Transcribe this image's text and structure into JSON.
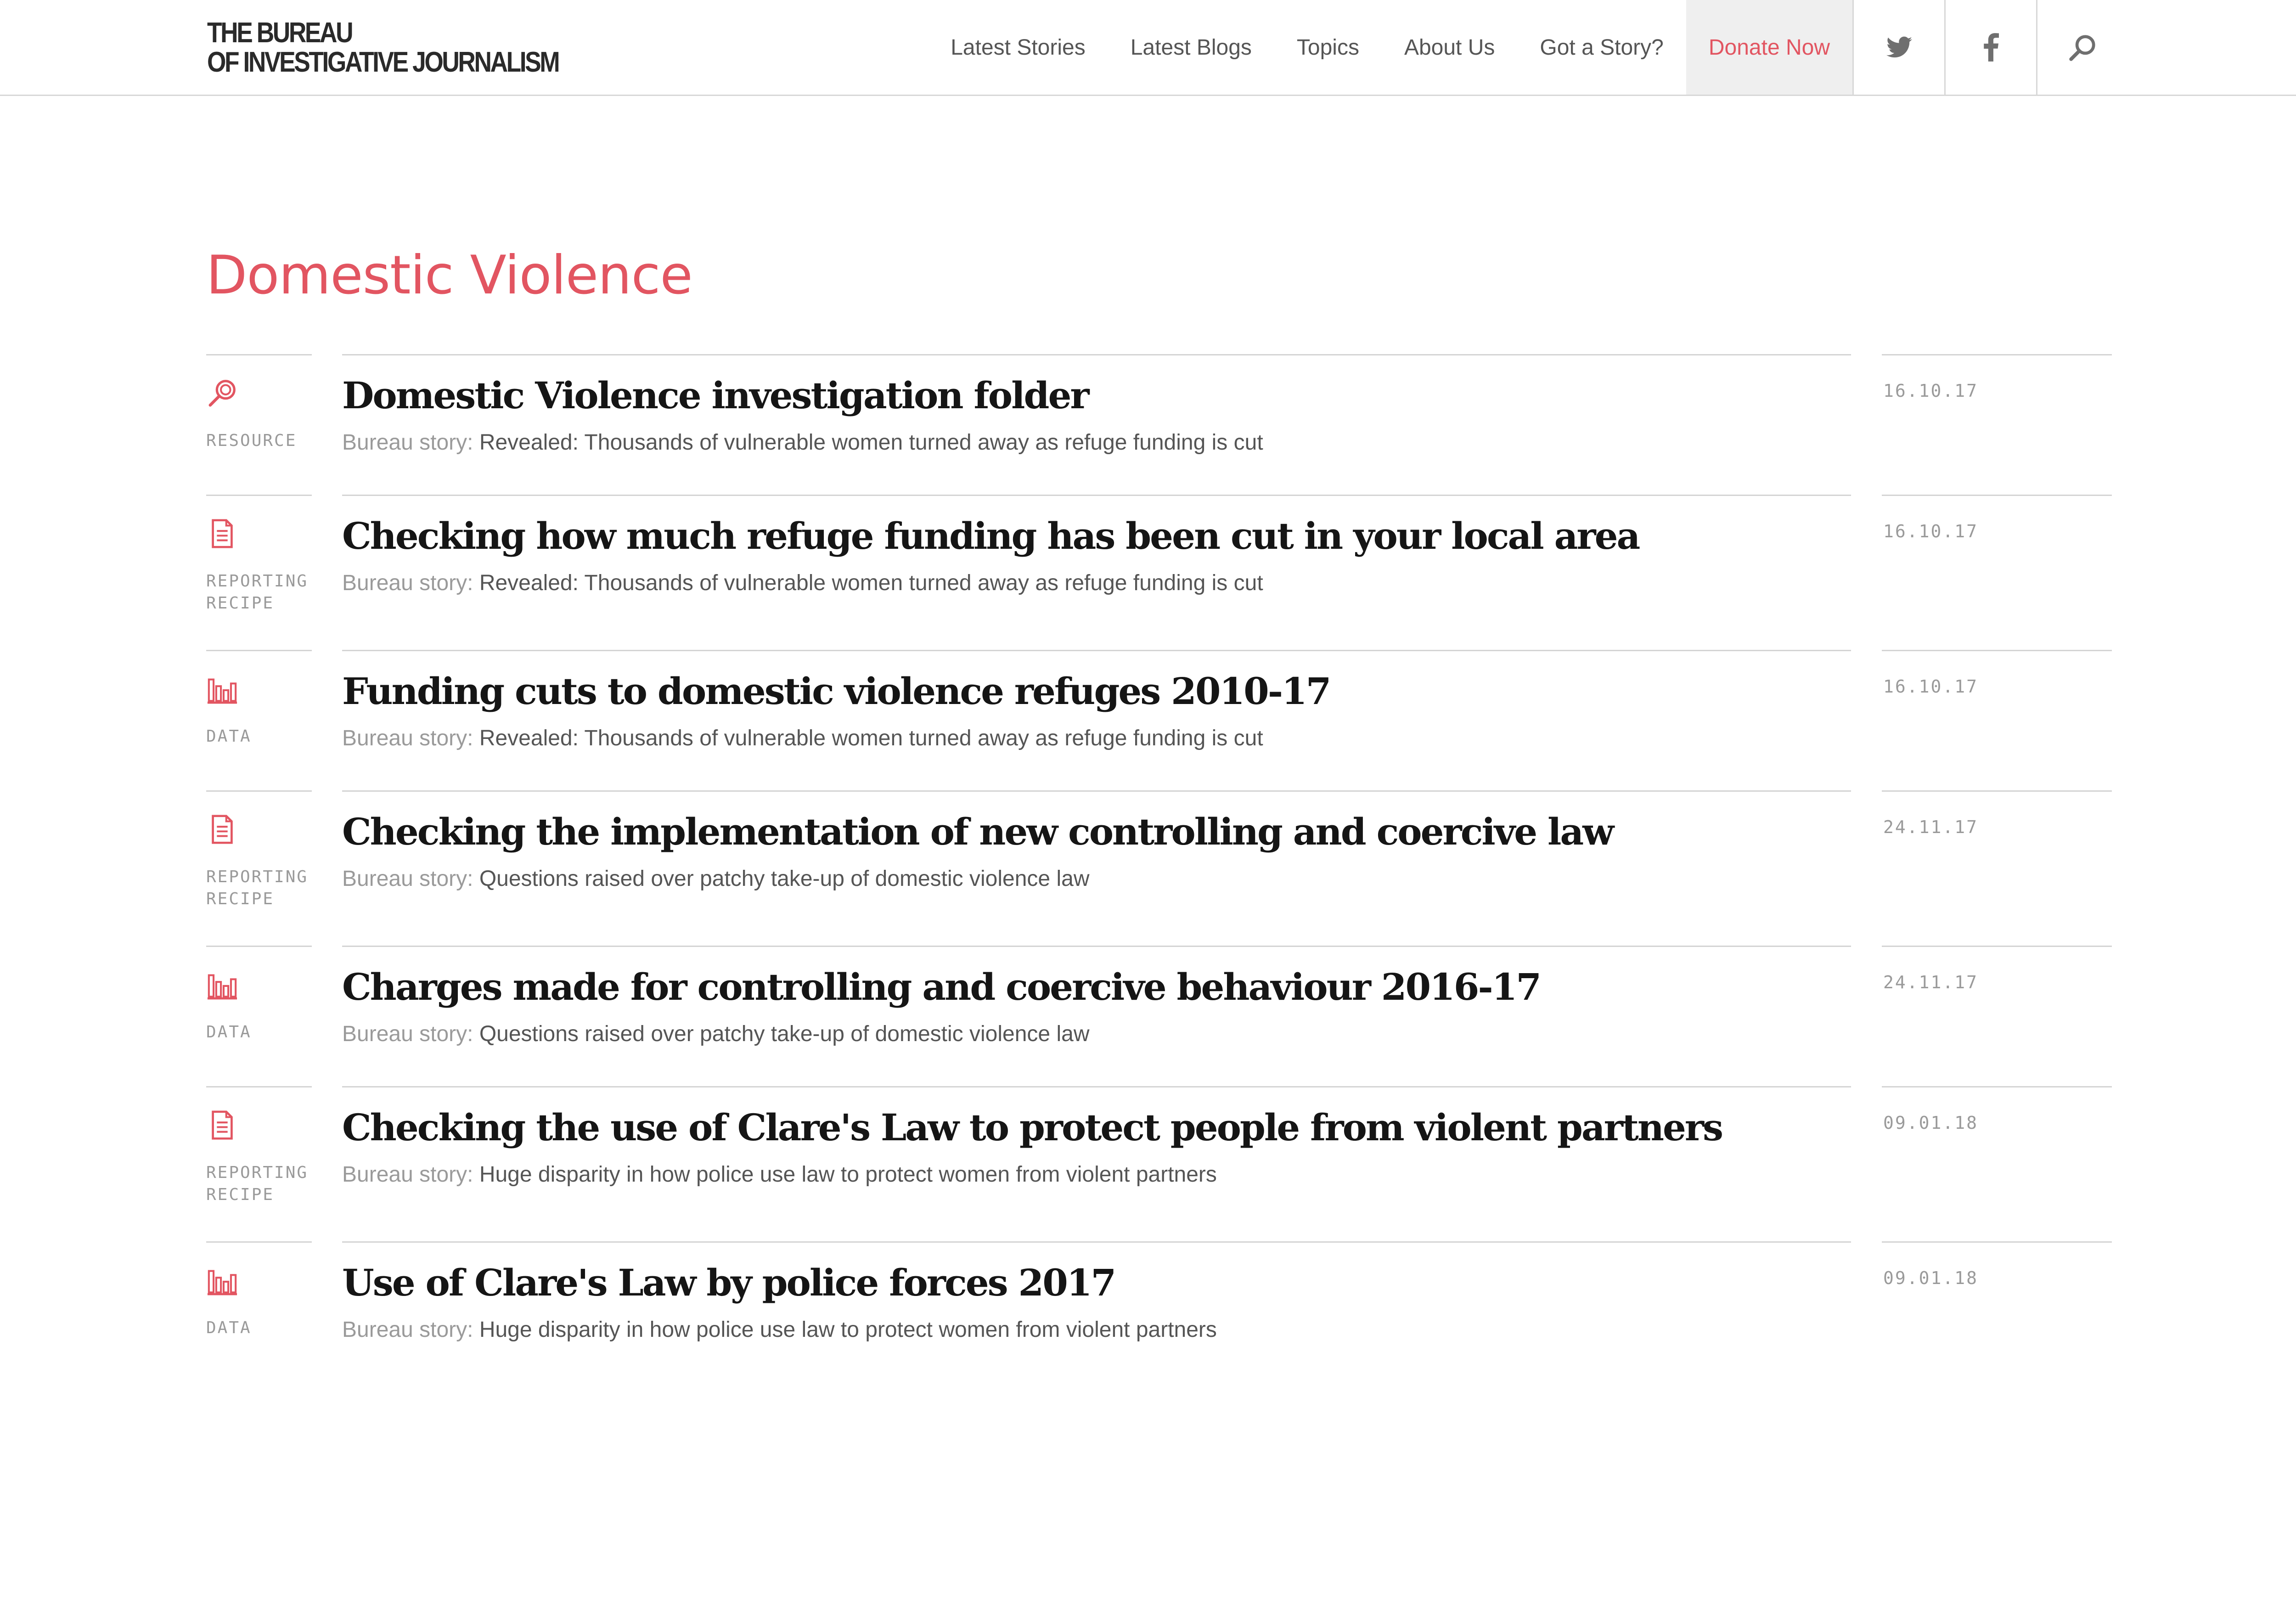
{
  "header": {
    "logo_line1": "THE BUREAU",
    "logo_line2": "OF INVESTIGATIVE JOURNALISM",
    "nav": [
      {
        "label": "Latest Stories"
      },
      {
        "label": "Latest Blogs"
      },
      {
        "label": "Topics"
      },
      {
        "label": "About Us"
      },
      {
        "label": "Got a Story?"
      },
      {
        "label": "Donate Now"
      }
    ],
    "icons": [
      "twitter-icon",
      "facebook-icon",
      "search-icon"
    ]
  },
  "colors": {
    "accent": "#e25561",
    "text": "#151515",
    "muted": "#9a9a9a",
    "rule": "#d4d4d4"
  },
  "page": {
    "title": "Domestic Violence"
  },
  "items": [
    {
      "type": "RESOURCE",
      "icon": "magnifier-icon",
      "title": "Domestic Violence investigation folder",
      "story_prefix": "Bureau story:",
      "story": "Revealed: Thousands of vulnerable women turned away as refuge funding is cut",
      "date": "16.10.17"
    },
    {
      "type": "REPORTING RECIPE",
      "icon": "document-icon",
      "title": "Checking how much refuge funding has been cut in your local area",
      "story_prefix": "Bureau story:",
      "story": "Revealed: Thousands of vulnerable women turned away as refuge funding is cut",
      "date": "16.10.17"
    },
    {
      "type": "DATA",
      "icon": "bar-chart-icon",
      "title": "Funding cuts to domestic violence refuges 2010-17",
      "story_prefix": "Bureau story:",
      "story": "Revealed: Thousands of vulnerable women turned away as refuge funding is cut",
      "date": "16.10.17"
    },
    {
      "type": "REPORTING RECIPE",
      "icon": "document-icon",
      "title": "Checking the implementation of new controlling and coercive law",
      "story_prefix": "Bureau story:",
      "story": "Questions raised over patchy take-up of domestic violence law",
      "date": "24.11.17"
    },
    {
      "type": "DATA",
      "icon": "bar-chart-icon",
      "title": "Charges made for controlling and coercive behaviour 2016-17",
      "story_prefix": "Bureau story:",
      "story": "Questions raised over patchy take-up of domestic violence law",
      "date": "24.11.17"
    },
    {
      "type": "REPORTING RECIPE",
      "icon": "document-icon",
      "title": "Checking the use of Clare's Law to protect people from violent partners",
      "story_prefix": "Bureau story:",
      "story": "Huge disparity in how police use law to protect women from violent partners",
      "date": "09.01.18"
    },
    {
      "type": "DATA",
      "icon": "bar-chart-icon",
      "title": "Use of Clare's Law by police forces 2017",
      "story_prefix": "Bureau story:",
      "story": "Huge disparity in how police use law to protect women from violent partners",
      "date": "09.01.18"
    }
  ]
}
